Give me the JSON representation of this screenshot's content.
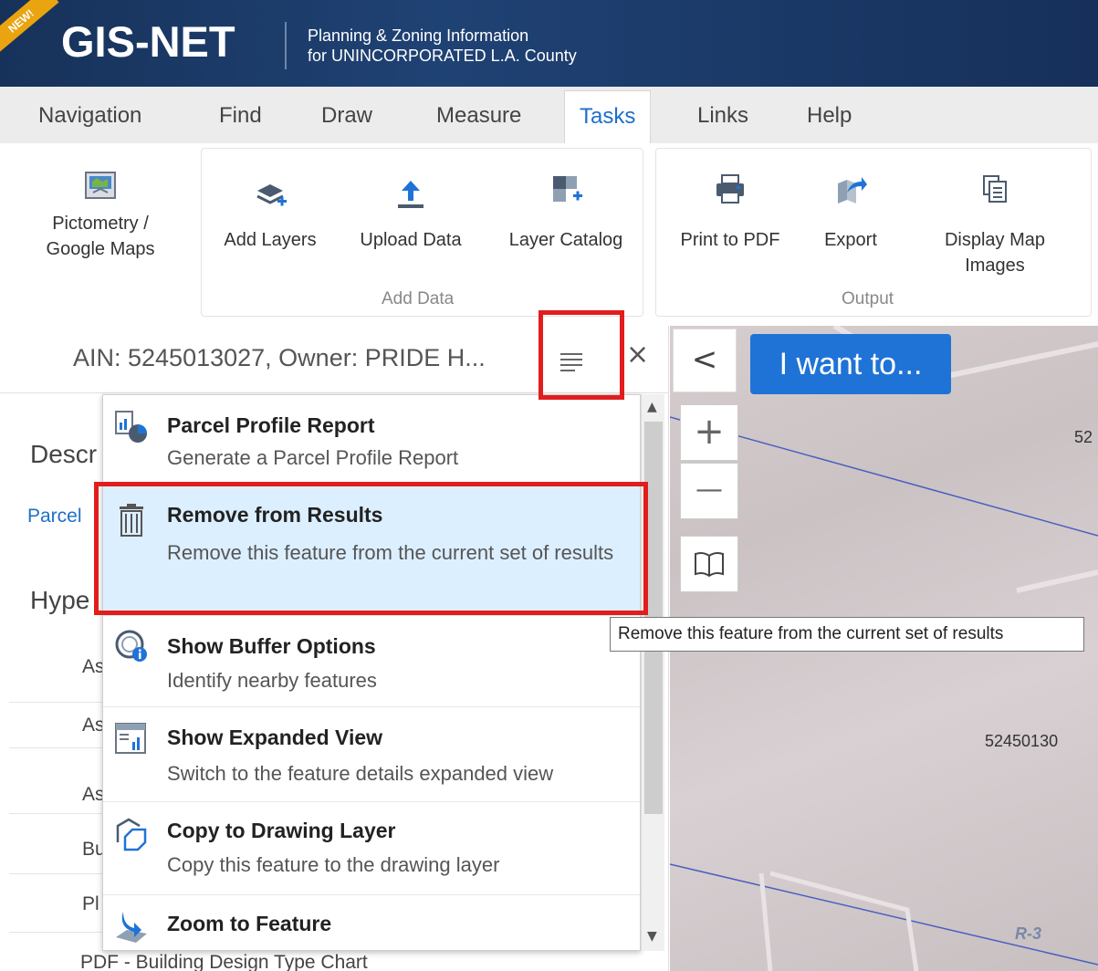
{
  "header": {
    "badge": "NEW!",
    "logo": "GIS-NET",
    "tagline_line1": "Planning & Zoning Information",
    "tagline_line2": "for UNINCORPORATED L.A. County"
  },
  "tabs": [
    {
      "label": "Navigation"
    },
    {
      "label": "Find"
    },
    {
      "label": "Draw"
    },
    {
      "label": "Measure"
    },
    {
      "label": "Tasks",
      "active": true
    },
    {
      "label": "Links"
    },
    {
      "label": "Help"
    }
  ],
  "ribbon": {
    "pictometry_line1": "Pictometry /",
    "pictometry_line2": "Google Maps",
    "add_layers": "Add Layers",
    "upload_data": "Upload Data",
    "layer_catalog": "Layer Catalog",
    "group_add_data": "Add Data",
    "print_pdf": "Print to PDF",
    "export": "Export",
    "display_line1": "Display Map",
    "display_line2": "Images",
    "group_output": "Output"
  },
  "panel": {
    "title": "AIN: 5245013027, Owner: PRIDE H...",
    "close": "×",
    "bg_desc": "Descr",
    "bg_parcel": "Parcel",
    "bg_hype": "Hype",
    "bg_rows": [
      "As",
      "As",
      "As",
      "Bu",
      "Pl"
    ],
    "bg_bottom": "PDF - Building Design Type Chart"
  },
  "menu": {
    "items": [
      {
        "title": "Parcel Profile Report",
        "desc": "Generate a Parcel Profile Report"
      },
      {
        "title": "Remove from Results",
        "desc": "Remove this feature from the current set of results"
      },
      {
        "title": "Show Buffer Options",
        "desc": "Identify nearby features"
      },
      {
        "title": "Show Expanded View",
        "desc": "Switch to the feature details expanded view"
      },
      {
        "title": "Copy to Drawing Layer",
        "desc": "Copy this feature to the drawing layer"
      },
      {
        "title": "Zoom to Feature",
        "desc": ""
      }
    ]
  },
  "map": {
    "collapse": "<",
    "i_want_to": "I want to...",
    "zoom_in": "+",
    "zoom_out": "—",
    "label_52": "52",
    "label_parcel": "52450130",
    "label_zone": "R-3",
    "tooltip": "Remove this feature from the current set of results"
  },
  "colors": {
    "header_bg": "#1c3b66",
    "accent_blue": "#1f73d6",
    "highlight_red": "#e21d1d",
    "menu_highlight": "#dcefff"
  }
}
